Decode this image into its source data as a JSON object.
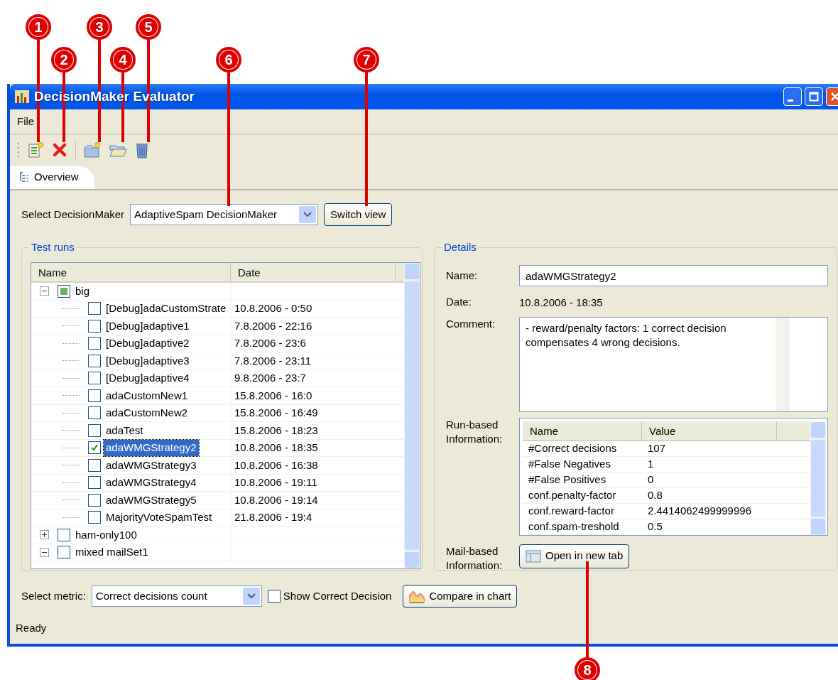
{
  "callouts": [
    {
      "number": "1"
    },
    {
      "number": "2"
    },
    {
      "number": "3"
    },
    {
      "number": "4"
    },
    {
      "number": "5"
    },
    {
      "number": "6"
    },
    {
      "number": "7"
    },
    {
      "number": "8"
    }
  ],
  "window": {
    "title": "DecisionMaker Evaluator"
  },
  "menu": [
    "File"
  ],
  "tabs": [
    {
      "label": "Overview",
      "selected": true
    }
  ],
  "selector": {
    "label": "Select DecisionMaker",
    "value": "AdaptiveSpam DecisionMaker",
    "button": "Switch view"
  },
  "test_runs": {
    "title": "Test runs",
    "columns": [
      "Name",
      "Date"
    ],
    "tree": [
      {
        "name": "big",
        "checked": false,
        "partial": true,
        "expanded": true,
        "selected": false,
        "children": [
          {
            "name": "[Debug]adaCustomStrate",
            "date": "10.8.2006 - 0:50",
            "checked": false,
            "selected": false
          },
          {
            "name": "[Debug]adaptive1",
            "date": "7.8.2006 - 22:16",
            "checked": false,
            "selected": false
          },
          {
            "name": "[Debug]adaptive2",
            "date": "7.8.2006 - 23:6",
            "checked": false,
            "selected": false
          },
          {
            "name": "[Debug]adaptive3",
            "date": "7.8.2006 - 23:11",
            "checked": false,
            "selected": false
          },
          {
            "name": "[Debug]adaptive4",
            "date": "9.8.2006 - 23:7",
            "checked": false,
            "selected": false
          },
          {
            "name": "adaCustomNew1",
            "date": "15.8.2006 - 16:0",
            "checked": false,
            "selected": false
          },
          {
            "name": "adaCustomNew2",
            "date": "15.8.2006 - 16:49",
            "checked": false,
            "selected": false
          },
          {
            "name": "adaTest",
            "date": "15.8.2006 - 18:23",
            "checked": false,
            "selected": false
          },
          {
            "name": "adaWMGStrategy2",
            "date": "10.8.2006 - 18:35",
            "checked": true,
            "selected": true
          },
          {
            "name": "adaWMGStrategy3",
            "date": "10.8.2006 - 16:38",
            "checked": false,
            "selected": false
          },
          {
            "name": "adaWMGStrategy4",
            "date": "10.8.2006 - 19:11",
            "checked": false,
            "selected": false
          },
          {
            "name": "adaWMGStrategy5",
            "date": "10.8.2006 - 19:14",
            "checked": false,
            "selected": false
          },
          {
            "name": "MajorityVoteSpamTest",
            "date": "21.8.2006 - 19:4",
            "checked": false,
            "selected": false
          }
        ]
      },
      {
        "name": "ham-only100",
        "checked": false,
        "partial": false,
        "expanded": false,
        "selected": false
      },
      {
        "name": "mixed mailSet1",
        "checked": false,
        "partial": false,
        "expanded": true,
        "selected": false
      }
    ]
  },
  "details": {
    "title": "Details",
    "name_label": "Name:",
    "name_value": "adaWMGStrategy2",
    "date_label": "Date:",
    "date_value": "10.8.2006 - 18:35",
    "comment_label": "Comment:",
    "comment": "- reward/penalty factors: 1 correct decision compensates 4 wrong decisions.",
    "run_label": "Run-based Information:",
    "run_columns": [
      "Name",
      "Value"
    ],
    "run_rows": [
      {
        "name": "#Correct decisions",
        "value": "107"
      },
      {
        "name": "#False Negatives",
        "value": "1"
      },
      {
        "name": "#False Positives",
        "value": "0"
      },
      {
        "name": "conf.penalty-factor",
        "value": "0.8"
      },
      {
        "name": "conf.reward-factor",
        "value": "2.4414062499999996"
      },
      {
        "name": "conf.spam-treshold",
        "value": "0.5"
      }
    ],
    "mail_label": "Mail-based Information:",
    "mail_button": "Open in new tab"
  },
  "metric": {
    "label": "Select metric:",
    "value": "Correct decisions count",
    "checkbox": {
      "label": "Show Correct Decision",
      "checked": false
    },
    "button": "Compare in chart"
  },
  "status_bar": "Ready"
}
